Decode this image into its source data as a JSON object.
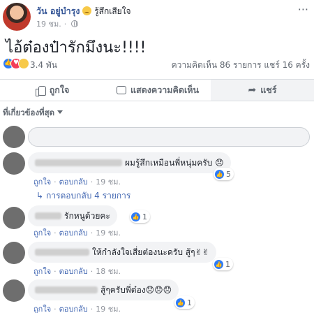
{
  "post": {
    "author": "วัน อยู่บำรุง",
    "feeling": "รู้สึกเสียใจ",
    "time": "19 ชม.",
    "text": "ไอ้ต๋องป๋ารักมึงนะ!!!!",
    "more_label": "···",
    "reactions_count": "3.4 พัน",
    "stats": "ความคิดเห็น 86 รายการ  แชร์ 16 ครั้ง"
  },
  "actions": {
    "like": "ถูกใจ",
    "comment": "แสดงความคิดเห็น",
    "share": "แชร์"
  },
  "filter": {
    "label": "ที่เกี่ยวข้องที่สุด"
  },
  "comment_meta": {
    "like": "ถูกใจ",
    "reply": "ตอบกลับ",
    "dot": "·"
  },
  "comments": [
    {
      "text": "ผมรู้สึกเหมือนพี่หนุ่มครับ 😞",
      "time": "19 ชม.",
      "likes": "5"
    },
    {
      "text": "รักหนูด้วยคะ",
      "time": "19 ชม.",
      "likes": "1"
    },
    {
      "text": "ให้กำลังใจเสี่ยต๋องนะครับ สู้ๆ✌✌",
      "time": "18 ชม.",
      "likes": "1"
    },
    {
      "text": "สู้ๆครับพี่ต๋อง😞😞😞",
      "time": "19 ชม.",
      "likes": "1"
    }
  ],
  "replies_link": "การตอบกลับ 4 รายการ",
  "colors": {
    "link_blue": "#4267b2",
    "name_blue": "#385898",
    "like_blue": "#2f7cf6",
    "love_red": "#f33e58",
    "meta_gray": "#90949c"
  }
}
